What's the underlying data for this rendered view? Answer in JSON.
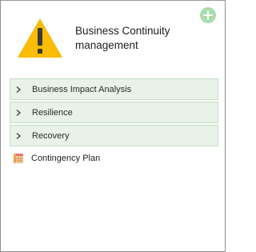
{
  "card": {
    "title": "Business Continuity management"
  },
  "sections": [
    {
      "label": "Business Impact Analysis"
    },
    {
      "label": "Resilience"
    },
    {
      "label": "Recovery"
    }
  ],
  "plan": {
    "label": "Contingency Plan"
  },
  "icons": {
    "warning": "warning-triangle-icon",
    "add": "plus-circle-icon",
    "chevron": "chevron-right-icon",
    "plan": "table-grid-icon"
  },
  "colors": {
    "warning_fill": "#fbbc05",
    "add_button": "#a9ddb0",
    "section_bg": "#e8f2e8",
    "section_border": "#c5ddc5"
  }
}
